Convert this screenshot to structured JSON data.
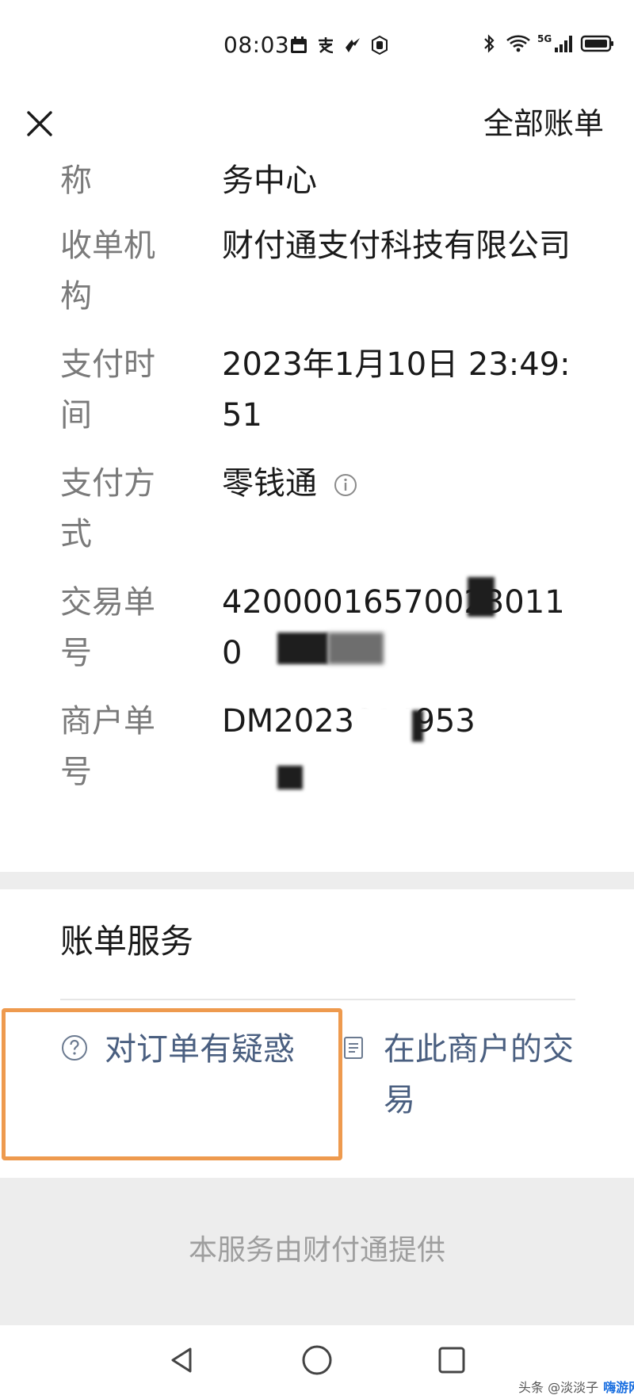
{
  "status_bar": {
    "time": "08:03",
    "network": "5G",
    "left_icons": [
      "calendar-icon",
      "alipay-icon",
      "app-icon",
      "hand-icon"
    ],
    "right_icons": [
      "bluetooth-icon",
      "wifi-icon",
      "signal-icon",
      "battery-icon"
    ]
  },
  "header": {
    "right_link": "全部账单"
  },
  "details": {
    "rows": [
      {
        "label": "称",
        "value": "务中心"
      },
      {
        "label": "收单机构",
        "value": "财付通支付科技有限公司"
      },
      {
        "label": "支付时间",
        "value": "2023年1月10日 23:49:51"
      },
      {
        "label": "支付方式",
        "value": "零钱通"
      },
      {
        "label": "交易单号",
        "value": "420000165700230110"
      },
      {
        "label": "商户单号",
        "value": "DM2023014953"
      }
    ]
  },
  "services": {
    "title": "账单服务",
    "items": [
      {
        "label": "对订单有疑惑",
        "icon": "question-circle-icon"
      },
      {
        "label": "在此商户的交易",
        "icon": "document-icon"
      }
    ]
  },
  "footer": {
    "text": "本服务由财付通提供"
  },
  "watermark": {
    "text": "头条 @淡淡子",
    "brand": "嗨游网"
  },
  "colors": {
    "link": "#4a5f80",
    "label": "#7a7a7a",
    "highlight": "#ee9a4e",
    "band": "#ededed"
  }
}
